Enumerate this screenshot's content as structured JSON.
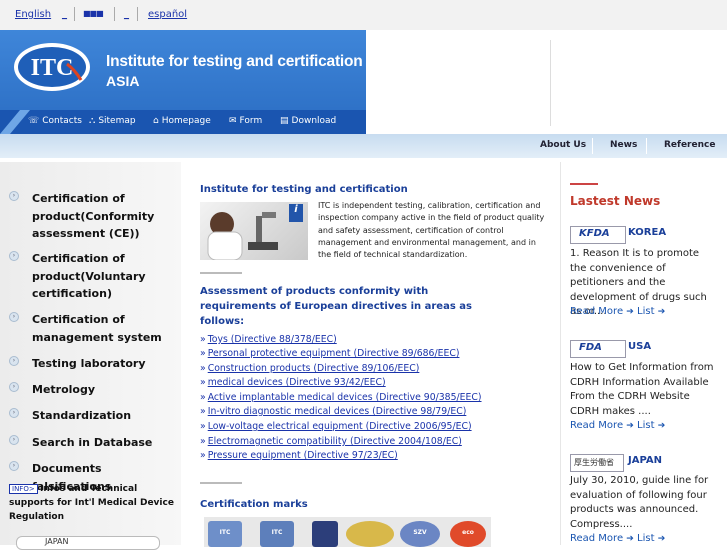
{
  "lang": {
    "english": "English",
    "sep1": "_",
    "cjk": "■■■",
    "sep2": "_",
    "espanol": "español"
  },
  "header": {
    "title": "Institute for testing and certification",
    "subtitle": "ASIA",
    "logo_text": "ITC"
  },
  "nav": {
    "contacts": "Contacts",
    "sitemap": "Sitemap",
    "homepage": "Homepage",
    "form": "Form",
    "download": "Download"
  },
  "band": {
    "about": "About Us",
    "news": "News",
    "reference": "Reference"
  },
  "sidebar": {
    "items": [
      "Certification of product(Conformity assessment (CE))",
      "Certification of product(Voluntary certification)",
      "Certification of management system",
      "Testing laboratory",
      "Metrology",
      "Standardization",
      "Search in Database",
      "Documents falsifications"
    ],
    "infos_badge": "INFO>",
    "infos_text": "Infos and Technical",
    "infos_text2": "supports for Int'l Medical Device Regulation",
    "jp_button": "JAPAN"
  },
  "main": {
    "title": "Institute for testing and certification",
    "desc": "ITC is independent testing, calibration, certification and inspection company active in the field of product quality and safety assessment, certification of control management and environmental management, and in the field of technical standardization.",
    "assess_title": "Assessment of products conformity with requirements of European directives in areas as follows:",
    "directives": [
      "Toys (Directive 88/378/EEC)",
      "Personal protective equipment (Directive 89/686/EEC)",
      "Construction products (Directive 89/106/EEC)",
      "medical devices (Directive 93/42/EEC)",
      "Active implantable medical devices (Directive 90/385/EEC)",
      "In-vitro diagnostic medical devices (Directive 98/79/EC)",
      "Low-voltage electrical equipment (Directive 2006/95/EC)",
      "Electromagnetic compatibility (Directive 2004/108/EC)",
      "Pressure equipment (Directive 97/23/EC)"
    ],
    "cert_marks_title": "Certification marks",
    "marks": [
      "ITC",
      "ITC",
      "",
      "",
      "SZV",
      "eco"
    ]
  },
  "news": {
    "title": "Lastest News",
    "items": [
      {
        "logo": "KFDA",
        "country": "KOREA",
        "text": "1. Reason It is to promote the convenience of petitioners and the development of drugs such as or....",
        "more": "Read More",
        "list": "List"
      },
      {
        "logo": "FDA",
        "country": "USA",
        "text": "How to Get Information from CDRH Information Available From the CDRH Website CDRH makes ....",
        "more": "Read More",
        "list": "List"
      },
      {
        "logo": "厚生労働省",
        "country": "JAPAN",
        "text": "July 30, 2010, guide line for evaluation of following four products was announced. Compress....",
        "more": "Read More",
        "list": "List"
      }
    ]
  }
}
